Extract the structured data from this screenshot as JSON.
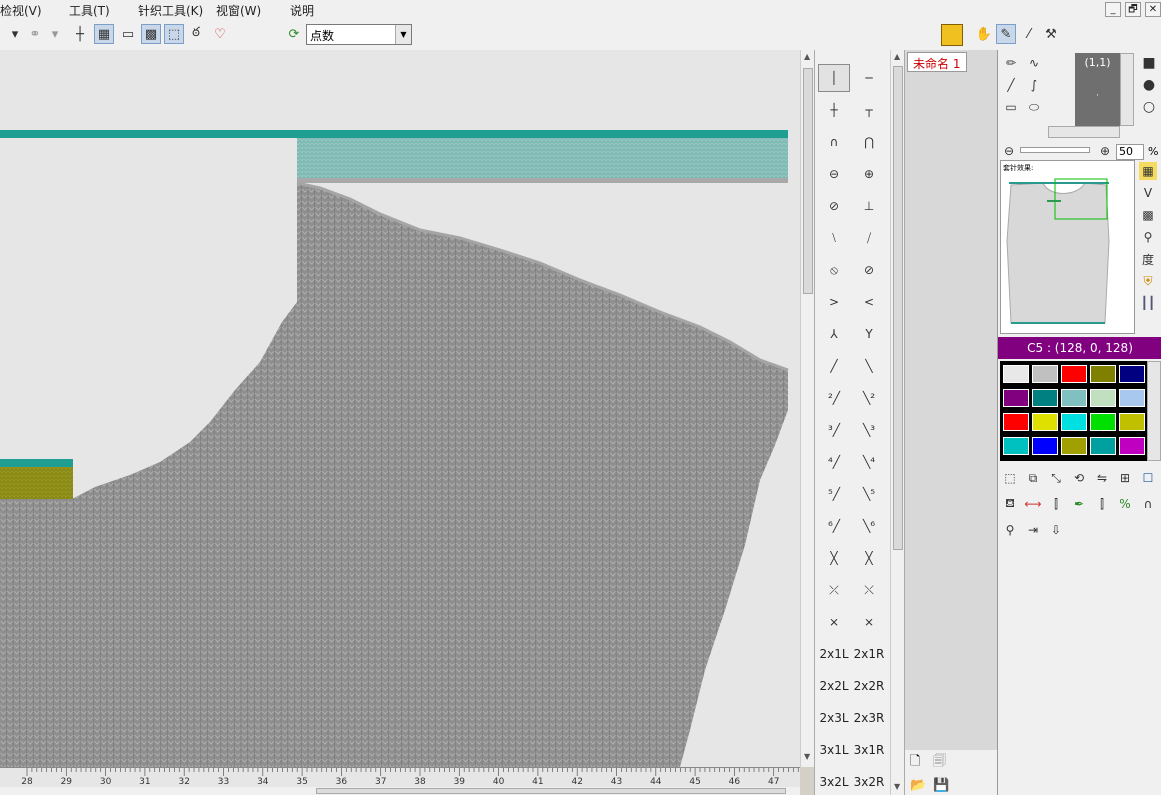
{
  "menu": {
    "items": [
      "检视(V)",
      "工具(T)",
      "针织工具(K)",
      "视窗(W)",
      "说明"
    ],
    "window_controls": [
      "_",
      "🗗",
      "✕"
    ]
  },
  "toolbar": {
    "mode_value": "点数"
  },
  "ruler": {
    "labels": [
      "28",
      "29",
      "30",
      "31",
      "32",
      "33",
      "34",
      "35",
      "36",
      "37",
      "38",
      "39",
      "40",
      "41",
      "42",
      "43",
      "44",
      "45",
      "46",
      "47"
    ]
  },
  "symbols": {
    "text_rows": [
      [
        "2x1L",
        "2x1R"
      ],
      [
        "2x2L",
        "2x2R"
      ],
      [
        "2x3L",
        "2x3R"
      ],
      [
        "3x1L",
        "3x1R"
      ],
      [
        "3x2L",
        "3x2R"
      ]
    ]
  },
  "document": {
    "tab_label": "未命名 1"
  },
  "right_panel": {
    "preview_coord": "(1,1)",
    "zoom_value": "50",
    "zoom_unit": "%",
    "color_header": "C5 : (128, 0, 128)",
    "swatches": [
      [
        "#e8e8e8",
        "#c0c0c0",
        "#ff0000",
        "#808000",
        "#000080"
      ],
      [
        "#800080",
        "#008080",
        "#80c0c0",
        "#c0e0c0",
        "#a8c8f0"
      ],
      [
        "#ff0000",
        "#e0e000",
        "#00e0e0",
        "#00e000",
        "#c0c000"
      ],
      [
        "#00c0c0",
        "#0000ff",
        "#a0a000",
        "#00a0a0",
        "#c000c0"
      ]
    ],
    "thumb_text": "套针效果:"
  },
  "colors": {
    "stitch_gray": "#8f8f8f",
    "teal_band": "#1f9f92",
    "teal_pale": "#7fb9b4",
    "olive": "#8a8a12",
    "canvas_bg": "#e6e6e6",
    "selected_color": "#800080"
  }
}
